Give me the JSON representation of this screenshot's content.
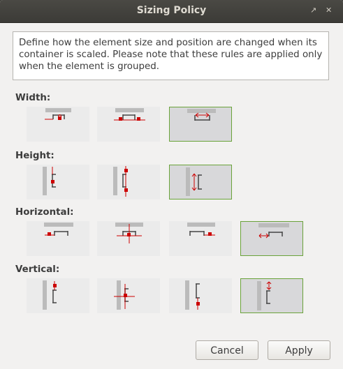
{
  "window": {
    "title": "Sizing Policy",
    "titlebar_icons": [
      "resize-icon",
      "close-icon"
    ]
  },
  "description": "Define how the element size and position are changed when its container is scaled. Please note that these rules are applied only when the element is grouped.",
  "sections": [
    {
      "label": "Width:",
      "options": [
        "width-fixed",
        "width-fixed-left-right",
        "width-scale"
      ],
      "selected": 2
    },
    {
      "label": "Height:",
      "options": [
        "height-fixed",
        "height-fixed-top-bottom",
        "height-scale"
      ],
      "selected": 2
    },
    {
      "label": "Horizontal:",
      "options": [
        "anchor-left",
        "anchor-center",
        "anchor-right",
        "horizontal-scale"
      ],
      "selected": 3
    },
    {
      "label": "Vertical:",
      "options": [
        "anchor-top",
        "anchor-middle",
        "anchor-bottom",
        "vertical-scale"
      ],
      "selected": 3
    }
  ],
  "buttons": {
    "cancel": "Cancel",
    "apply": "Apply"
  },
  "colors": {
    "accent": "#cc0000",
    "selected_border": "#6aa33a",
    "titlebar": "#3c3b37"
  }
}
